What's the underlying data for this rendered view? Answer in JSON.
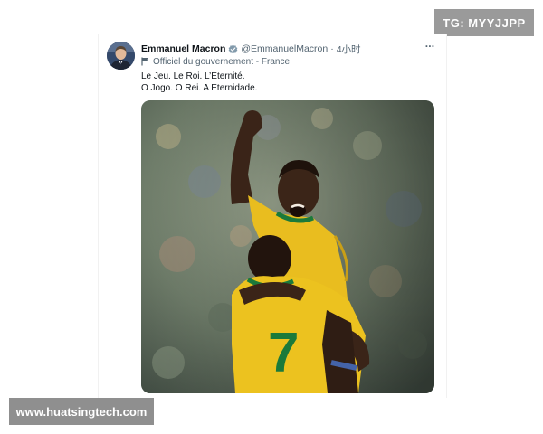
{
  "watermarks": {
    "top_right": "TG: MYYJJPP",
    "bottom_left": "www.huatsingtech.com"
  },
  "tweet": {
    "author": {
      "display_name": "Emmanuel Macron",
      "verified": true,
      "handle": "@EmmanuelMacron",
      "separator": "·",
      "time_ago": "4小时",
      "affiliation": "Officiel du gouvernement - France"
    },
    "text_lines": [
      "Le Jeu. Le Roi. L’Éternité.",
      "O Jogo. O Rei. A Eternidade."
    ],
    "more_label": "···",
    "media": {
      "jersey_number": "7"
    }
  },
  "icons": {
    "avatar": "avatar",
    "verified": "verified-badge-icon",
    "affiliation": "flag-icon",
    "more": "more-options-icon"
  },
  "colors": {
    "text_primary": "#0f1419",
    "text_secondary": "#536471",
    "verified_blue": "#1d9bf0",
    "jersey_yellow": "#f2c21b",
    "jersey_green": "#1b7a3a"
  }
}
